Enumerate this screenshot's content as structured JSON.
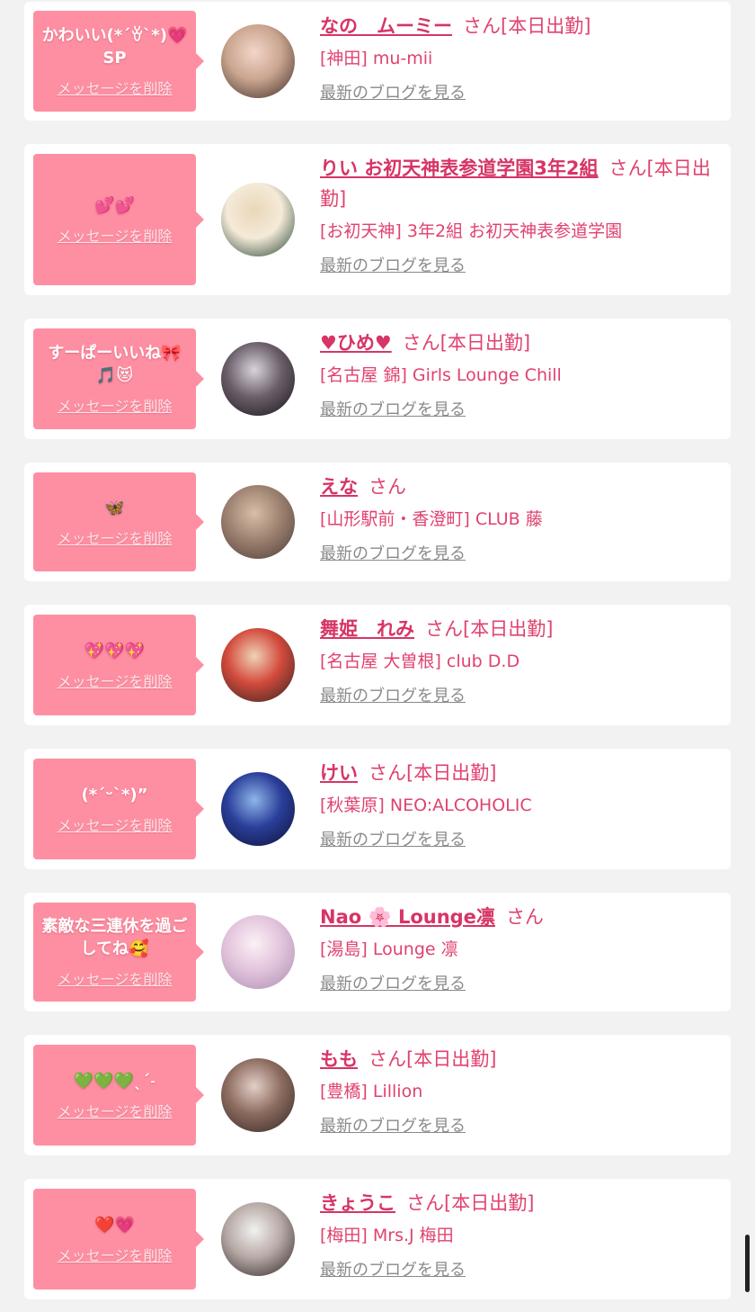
{
  "items": [
    {
      "message": "かわいい(*´ꈊ`*)💗SP",
      "delete_label": "メッセージを削除",
      "name": "なの　ムーミー",
      "suffix": "さん[本日出勤]",
      "store": "[神田] mu-mii",
      "blog_label": "最新のブログを見る",
      "avatar_colors": [
        "#f3d6c9",
        "#caa58f",
        "#3a2a26"
      ]
    },
    {
      "message": "💕💕",
      "delete_label": "メッセージを削除",
      "name": "りい お初天神表参道学園3年2組",
      "suffix": "さん[本日出勤]",
      "store": "[お初天神] 3年2組 お初天神表参道学園",
      "blog_label": "最新のブログを見る",
      "avatar_colors": [
        "#e9d7b8",
        "#f5ead9",
        "#1d3e2b"
      ]
    },
    {
      "message": "すーぱーいいね🎀🎵😻",
      "delete_label": "メッセージを削除",
      "name": "♥ひめ♥",
      "suffix": "さん[本日出勤]",
      "store": "[名古屋 錦] Girls Lounge Chill",
      "blog_label": "最新のブログを見る",
      "avatar_colors": [
        "#d9d3dd",
        "#6b5f6a",
        "#151216"
      ]
    },
    {
      "message": "🦋",
      "delete_label": "メッセージを削除",
      "name": "えな",
      "suffix": "さん",
      "store": "[山形駅前・香澄町] CLUB 藤",
      "blog_label": "最新のブログを見る",
      "avatar_colors": [
        "#d7bfa9",
        "#9d8170",
        "#4a3b35"
      ]
    },
    {
      "message": "💖💖💖",
      "delete_label": "メッセージを削除",
      "name": "舞姫　れみ",
      "suffix": "さん[本日出勤]",
      "store": "[名古屋 大曽根] club D.D",
      "blog_label": "最新のブログを見る",
      "avatar_colors": [
        "#efd2b7",
        "#d34a3c",
        "#2b2321"
      ]
    },
    {
      "message": "(*ˊᵕˋ*)”",
      "delete_label": "メッセージを削除",
      "name": "けい",
      "suffix": "さん[本日出勤]",
      "store": "[秋葉原] NEO:ALCOHOLIC",
      "blog_label": "最新のブログを見る",
      "avatar_colors": [
        "#8fb5e8",
        "#2a3f9a",
        "#0c0f33"
      ]
    },
    {
      "message": "素敵な三連休を過ごしてね🥰",
      "delete_label": "メッセージを削除",
      "name": "Nao 🌸 Lounge凛",
      "suffix": "さん",
      "store": "[湯島] Lounge 凛",
      "blog_label": "最新のブログを見る",
      "avatar_colors": [
        "#fbf1f6",
        "#e3c4dc",
        "#a98bb1"
      ]
    },
    {
      "message": "💚💚💚ˎˊ˗",
      "delete_label": "メッセージを削除",
      "name": "もも",
      "suffix": "さん[本日出勤]",
      "store": "[豊橋] Lillion",
      "blog_label": "最新のブログを見る",
      "avatar_colors": [
        "#e3cfc7",
        "#8d6c5f",
        "#2e2522"
      ]
    },
    {
      "message": "❤️💗",
      "delete_label": "メッセージを削除",
      "name": "きょうこ",
      "suffix": "さん[本日出勤]",
      "store": "[梅田] Mrs.J 梅田",
      "blog_label": "最新のブログを見る",
      "avatar_colors": [
        "#f2f2f2",
        "#b7a9a5",
        "#2a2323"
      ]
    }
  ],
  "colors": {
    "page_background": "#f2f2f2",
    "card_background": "#ffffff",
    "bubble_pink": "#fe8fa2",
    "name_pink": "#d63565",
    "text_pink": "#e0426e",
    "link_gray": "#8a8a8a"
  }
}
